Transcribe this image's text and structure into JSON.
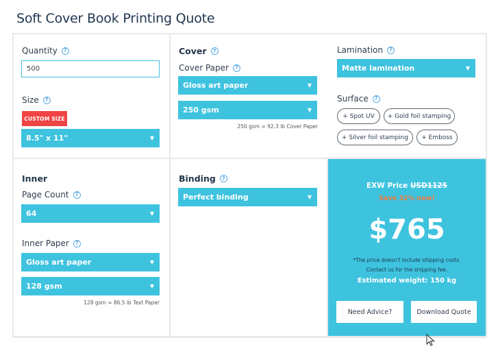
{
  "title": "Soft Cover Book Printing Quote",
  "quantity": {
    "label": "Quantity",
    "value": "500"
  },
  "size": {
    "label": "Size",
    "custom_button": "CUSTOM SIZE",
    "selected": "8.5\" x 11\""
  },
  "cover": {
    "label": "Cover",
    "paper_label": "Cover Paper",
    "paper_selected": "Gloss art paper",
    "weight_selected": "250 gsm",
    "weight_note": "250 gsm ≈ 92.3 lb Cover Paper"
  },
  "lamination": {
    "label": "Lamination",
    "selected": "Matte lamination"
  },
  "surface": {
    "label": "Surface",
    "options": [
      "+ Spot UV",
      "+ Gold foil stamping",
      "+ Silver foil stamping",
      "+ Emboss"
    ]
  },
  "inner": {
    "label": "Inner",
    "page_count_label": "Page Count",
    "page_count_selected": "64",
    "paper_label": "Inner Paper",
    "paper_selected": "Gloss art paper",
    "weight_selected": "128 gsm",
    "weight_note": "128 gsm ≈ 86.5 lb Text Paper"
  },
  "binding": {
    "label": "Binding",
    "selected": "Perfect binding"
  },
  "price": {
    "exw_label": "EXW Price",
    "original": "USD1125",
    "save_text": "Save 32% now!",
    "amount": "$765",
    "note_line1": "*The price doesn't include shipping costs.",
    "note_line2": "Contact us for the shipping fee.",
    "weight_label": "Estimated weight:",
    "weight_value": "150 kg",
    "advice_button": "Need Advice?",
    "download_button": "Download Quote"
  },
  "icons": {
    "info": "info-icon",
    "dropdown": "chevron-down-icon",
    "cursor": "mouse-pointer-icon"
  },
  "colors": {
    "accent": "#3ec3df",
    "custom_size_button": "#ef4444",
    "save_text": "#f07b3a",
    "title": "#1f3550"
  }
}
